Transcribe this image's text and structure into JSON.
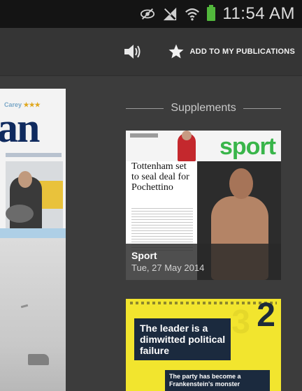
{
  "status_bar": {
    "time": "11:54 AM",
    "icons": [
      "eye-icon",
      "no-signal-icon",
      "wifi-icon",
      "battery-icon"
    ],
    "battery_color": "#52b83c"
  },
  "action_bar": {
    "volume_icon": "volume-icon",
    "add_to_publications_icon": "star-icon",
    "add_to_publications_label": "ADD TO MY PUBLICATIONS"
  },
  "left_paper": {
    "strap": "Carey",
    "strap_stars": "★★★",
    "masthead": "an"
  },
  "supplements": {
    "title": "Supplements",
    "items": [
      {
        "masthead": "sport",
        "headline": "Tottenham set to seal deal for Pochettino",
        "title": "Sport",
        "date": "Tue, 27 May 2014",
        "masthead_color": "#39b54a"
      },
      {
        "masthead": "2",
        "headline": "The leader is a dimwitted political failure",
        "subheadline": "The party has become a Frankenstein's monster",
        "background_color": "#f2e52e"
      }
    ]
  }
}
